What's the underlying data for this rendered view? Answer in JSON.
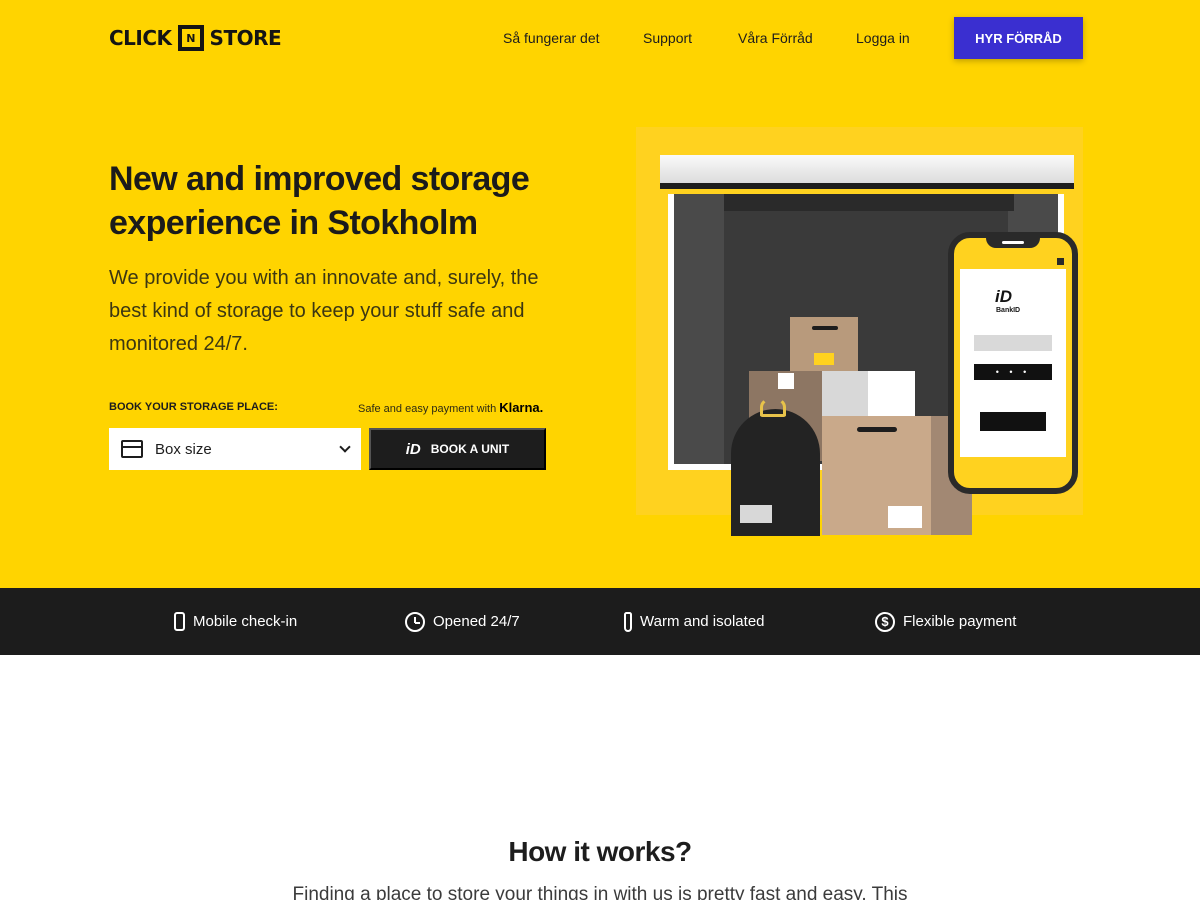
{
  "brand": {
    "left": "CLICK",
    "middle": "N",
    "right": "STORE"
  },
  "nav": {
    "items": [
      "Så fungerar det",
      "Support",
      "Våra Förråd",
      "Logga in"
    ],
    "cta": "HYR FÖRRÅD"
  },
  "hero": {
    "title": "New and improved storage experience in Stokholm",
    "subtitle": "We provide you with an innovate and, surely, the best kind of storage to keep your stuff safe and monitored 24/7.",
    "book_label": "BOOK YOUR STORAGE PLACE:",
    "payment_note": "Safe and easy payment with",
    "payment_brand": "Klarna.",
    "select_value": "Box size",
    "book_button": "BOOK A UNIT",
    "book_button_icon_text": "iD"
  },
  "illustration": {
    "phone_logo": "iD",
    "phone_logo_text": "BankID",
    "password_dots": "• • •"
  },
  "features": [
    {
      "icon": "mobile-icon",
      "label": "Mobile check-in"
    },
    {
      "icon": "alarm-clock-icon",
      "label": "Opened 24/7"
    },
    {
      "icon": "thermometer-icon",
      "label": "Warm and isolated"
    },
    {
      "icon": "dollar-icon",
      "label": "Flexible payment"
    }
  ],
  "how": {
    "title": "How it works?",
    "subtitle": "Finding a place to store your things in with us is pretty fast and easy. This"
  },
  "colors": {
    "brand_yellow": "#ffd400",
    "cta_blue": "#3a2fd0",
    "dark": "#1c1c1c"
  }
}
